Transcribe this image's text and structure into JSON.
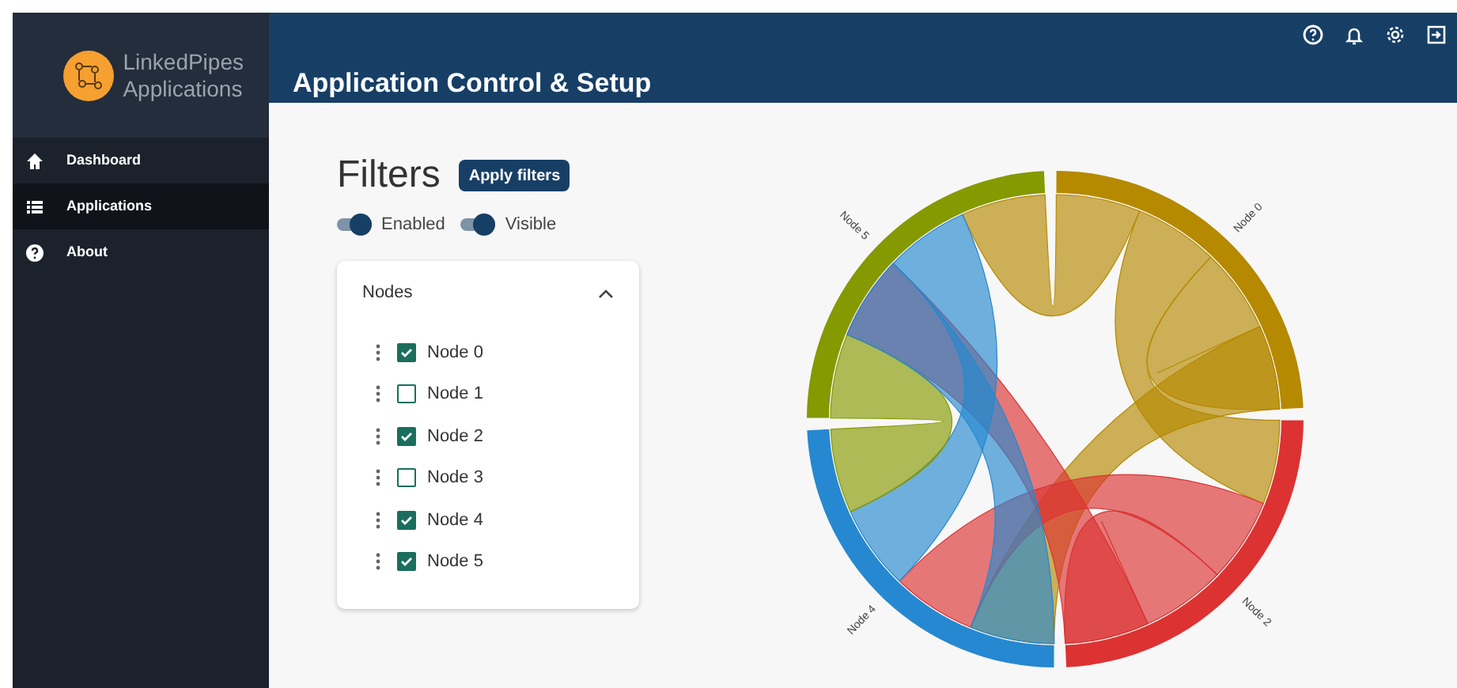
{
  "sidebar": {
    "logo_text": [
      "LinkedPipes",
      "Applications"
    ],
    "items": [
      {
        "label": "Dashboard",
        "selected": false
      },
      {
        "label": "Applications",
        "selected": true
      },
      {
        "label": "About",
        "selected": false
      }
    ]
  },
  "header": {
    "title": "Application Control & Setup"
  },
  "filters": {
    "title": "Filters",
    "apply_button": "Apply filters",
    "toggles": [
      {
        "label": "Enabled",
        "on": true
      },
      {
        "label": "Visible",
        "on": true
      }
    ],
    "panel": {
      "title": "Nodes",
      "expanded": true,
      "nodes": [
        {
          "label": "Node 0",
          "checked": true
        },
        {
          "label": "Node 1",
          "checked": false
        },
        {
          "label": "Node 2",
          "checked": true
        },
        {
          "label": "Node 3",
          "checked": false
        },
        {
          "label": "Node 4",
          "checked": true
        },
        {
          "label": "Node 5",
          "checked": true
        }
      ]
    }
  },
  "diagram": {
    "groups": [
      {
        "label": "Node 0",
        "color": "#b58900"
      },
      {
        "label": "Node 2",
        "color": "#dc3232"
      },
      {
        "label": "Node 4",
        "color": "#2688d0"
      },
      {
        "label": "Node 5",
        "color": "#859900"
      }
    ]
  }
}
